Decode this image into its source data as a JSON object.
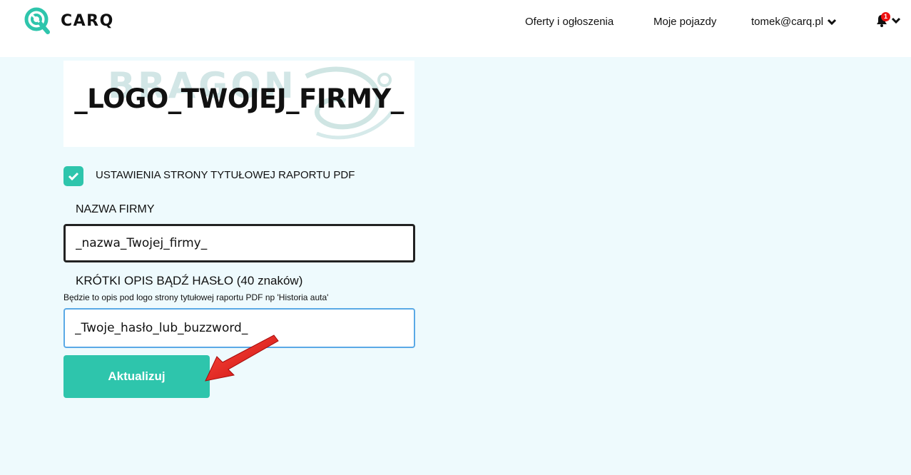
{
  "header": {
    "brand": "CARQ",
    "nav": {
      "offers": "Oferty i ogłoszenia",
      "vehicles": "Moje pojazdy",
      "user": "tomek@carq.pl"
    },
    "notifications_count": "1",
    "brand_color": "#2ec5ac"
  },
  "form": {
    "logo_placeholder": "_LOGO_TWOJEJ_FIRMY_",
    "logo_watermark": "BRAGON",
    "checkbox_label": "USTAWIENIA STRONY TYTUŁOWEJ RAPORTU PDF",
    "checkbox_checked": true,
    "company_label": "NAZWA FIRMY",
    "company_value": "_nazwa_Twojej_firmy_",
    "desc_label": "KRÓTKI OPIS BĄDŹ HASŁO (40 znaków)",
    "desc_hint": "Będzie to opis pod logo strony tytułowej raportu PDF np 'Historia auta'",
    "desc_value": "_Twoje_hasło_lub_buzzword_",
    "submit_label": "Aktualizuj"
  },
  "icons": [
    "carq-logo-icon",
    "chevron-down-icon",
    "bell-icon",
    "check-icon",
    "red-arrow-icon",
    "dragon-icon"
  ]
}
